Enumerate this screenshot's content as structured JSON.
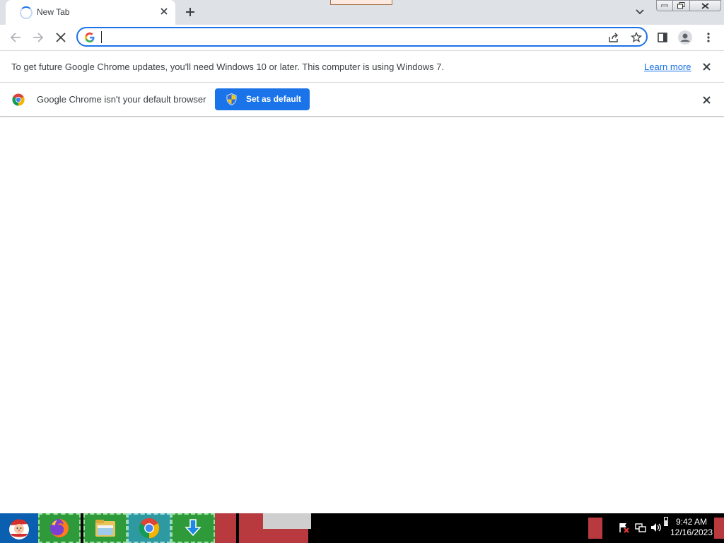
{
  "browser": {
    "tab": {
      "title": "New Tab"
    },
    "omnibox": {
      "value": "",
      "placeholder": ""
    }
  },
  "infobars": {
    "update": {
      "message": "To get future Google Chrome updates, you'll need Windows 10 or later. This computer is using Windows 7.",
      "link": "Learn more"
    },
    "default_browser": {
      "message": "Google Chrome isn't your default browser",
      "button": "Set as default"
    }
  },
  "taskbar": {
    "clock": {
      "time": "9:42 AM",
      "date": "12/16/2023"
    },
    "items": [
      "firefox-icon",
      "file-explorer-icon",
      "chrome-icon",
      "download-icon"
    ]
  },
  "colors": {
    "accent": "#1a73e8",
    "tabstrip": "#dee1e6",
    "taskbar": "#000000"
  }
}
